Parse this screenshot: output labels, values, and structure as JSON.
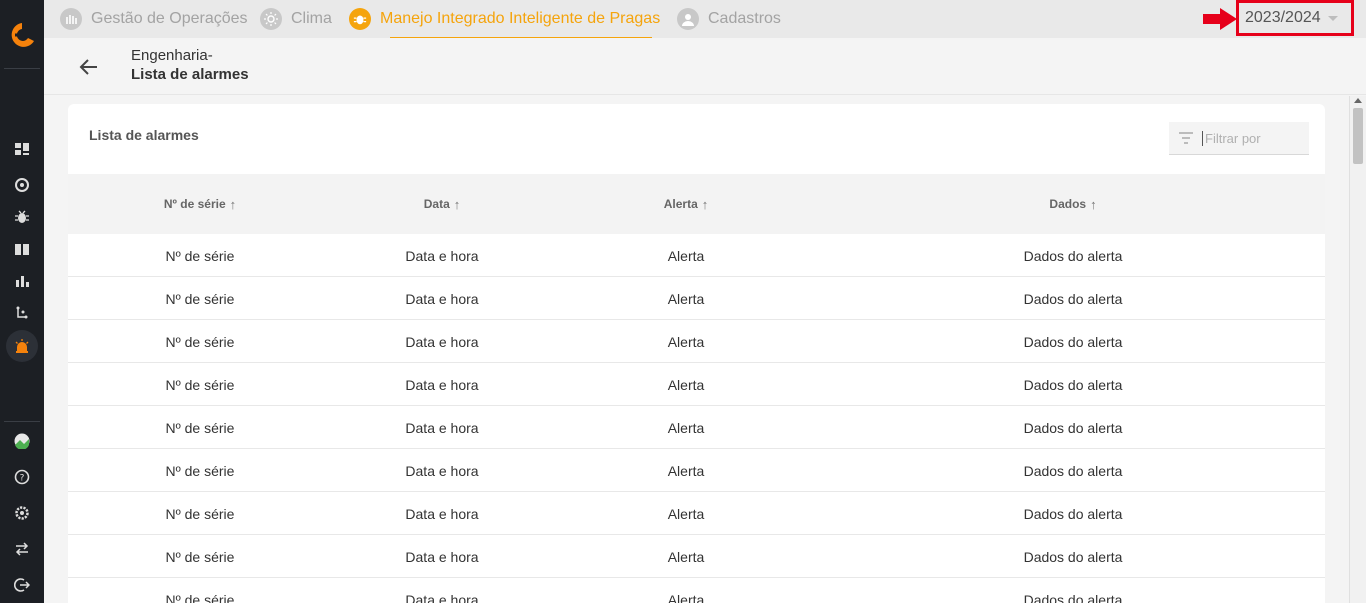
{
  "sidebar": {
    "icons": [
      "dashboard-icon",
      "radar-icon",
      "bug-icon",
      "book-icon",
      "chart-icon",
      "flow-icon",
      "alarm-icon",
      "avatar",
      "help-icon",
      "settings-icon",
      "swap-icon",
      "logout-icon"
    ]
  },
  "topnav": {
    "tabs": [
      {
        "label": "Gestão de Operações",
        "icon": "operations-icon"
      },
      {
        "label": "Clima",
        "icon": "sun-icon"
      },
      {
        "label": "Manejo Integrado Inteligente de Pragas",
        "icon": "bug-icon",
        "active": true
      },
      {
        "label": "Cadastros",
        "icon": "user-icon"
      }
    ],
    "season": "2023/2024"
  },
  "breadcrumb": {
    "parent": "Engenharia-",
    "current": "Lista de alarmes"
  },
  "card": {
    "title": "Lista de alarmes",
    "filter_placeholder": "Filtrar por"
  },
  "table": {
    "headers": [
      "Nº de série",
      "Data",
      "Alerta",
      "Dados"
    ],
    "rows": [
      [
        "Nº de série",
        "Data e hora",
        "Alerta",
        "Dados do alerta"
      ],
      [
        "Nº de série",
        "Data e hora",
        "Alerta",
        "Dados do alerta"
      ],
      [
        "Nº de série",
        "Data e hora",
        "Alerta",
        "Dados do alerta"
      ],
      [
        "Nº de série",
        "Data e hora",
        "Alerta",
        "Dados do alerta"
      ],
      [
        "Nº de série",
        "Data e hora",
        "Alerta",
        "Dados do alerta"
      ],
      [
        "Nº de série",
        "Data e hora",
        "Alerta",
        "Dados do alerta"
      ],
      [
        "Nº de série",
        "Data e hora",
        "Alerta",
        "Dados do alerta"
      ],
      [
        "Nº de série",
        "Data e hora",
        "Alerta",
        "Dados do alerta"
      ],
      [
        "Nº de série",
        "Data e hora",
        "Alerta",
        "Dados do alerta"
      ]
    ]
  },
  "colors": {
    "accent": "#f5a40c",
    "sidebar": "#1c1f24",
    "highlight": "#e6001a"
  }
}
